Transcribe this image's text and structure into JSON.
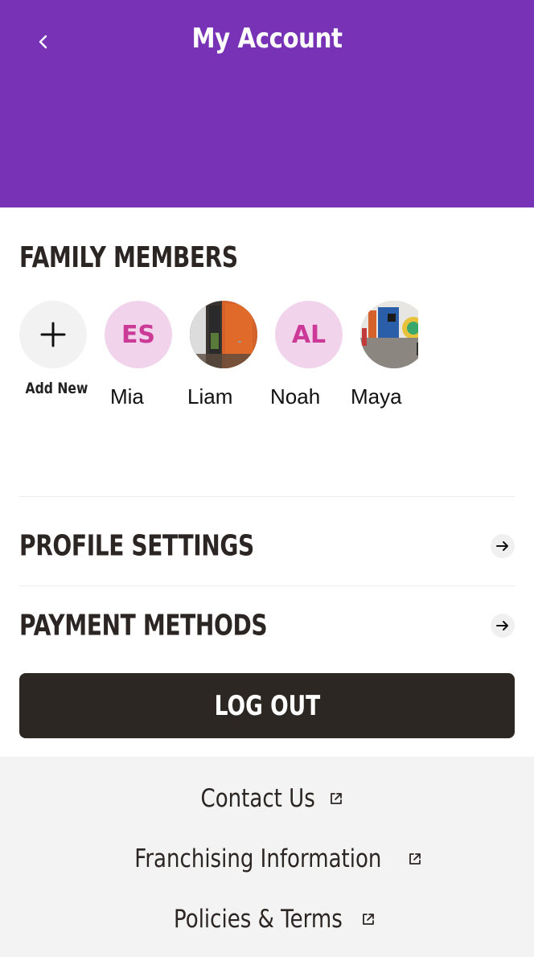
{
  "header": {
    "title": "My Account",
    "back_icon": "chevron-left-icon",
    "color": "#7832b6"
  },
  "family": {
    "title": "FAMILY MEMBERS",
    "add_label": "Add New",
    "members": [
      {
        "initials": "ES",
        "name": "Mia"
      },
      {
        "initials": "",
        "name": "Liam",
        "photo": "photo-avatar-orange-door"
      },
      {
        "initials": "AL",
        "name": "Noah"
      },
      {
        "initials": "",
        "name": "Maya",
        "photo": "photo-avatar-playroom"
      }
    ]
  },
  "menu": {
    "profile_settings": "PROFILE SETTINGS",
    "payment_methods": "PAYMENT METHODS"
  },
  "logout_label": "LOG OUT",
  "footer": {
    "contact": "Contact Us",
    "franchising": "Franchising Information",
    "policies": "Policies & Terms"
  },
  "colors": {
    "accent": "#7832b6",
    "dark": "#2d2724",
    "avatar_bg": "#f2d3ec",
    "avatar_text": "#cc3a98"
  }
}
